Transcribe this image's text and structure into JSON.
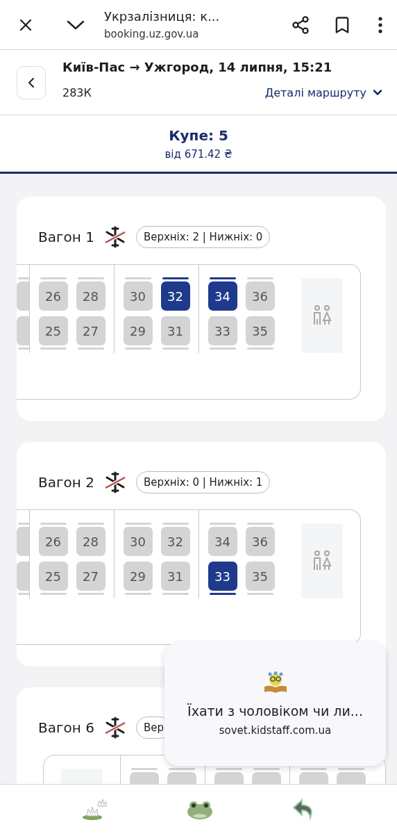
{
  "browser": {
    "title": "Укрзалізниця: к...",
    "url": "booking.uz.gov.ua"
  },
  "header": {
    "route": "Київ-Пас → Ужгород, 14 липня, 15:21",
    "train": "283К",
    "details_link": "Деталі маршруту"
  },
  "tabs": [
    {
      "label": "Купе: 5",
      "price": "від 671.42 ₴",
      "selected": true
    }
  ],
  "wagons": [
    {
      "title": "Вагон 1",
      "berths": "Верхніх: 2 | Нижніх: 0",
      "compartments": [
        {
          "kind": "partial",
          "upper": [
            {
              "selected": false
            }
          ],
          "lower": [
            {
              "selected": false
            }
          ]
        },
        {
          "kind": "seats",
          "upper": [
            {
              "number": "26",
              "selected": false
            },
            {
              "number": "28",
              "selected": false
            }
          ],
          "lower": [
            {
              "number": "25",
              "selected": false
            },
            {
              "number": "27",
              "selected": false
            }
          ]
        },
        {
          "kind": "seats",
          "upper": [
            {
              "number": "30",
              "selected": false
            },
            {
              "number": "32",
              "selected": true
            }
          ],
          "lower": [
            {
              "number": "29",
              "selected": false
            },
            {
              "number": "31",
              "selected": false
            }
          ]
        },
        {
          "kind": "seats",
          "upper": [
            {
              "number": "34",
              "selected": true
            },
            {
              "number": "36",
              "selected": false
            }
          ],
          "lower": [
            {
              "number": "33",
              "selected": false
            },
            {
              "number": "35",
              "selected": false
            }
          ]
        },
        {
          "kind": "toilet"
        }
      ]
    },
    {
      "title": "Вагон 2",
      "berths": "Верхніх: 0 | Нижніх: 1",
      "compartments": [
        {
          "kind": "partial",
          "upper": [
            {
              "selected": false
            }
          ],
          "lower": [
            {
              "selected": false
            }
          ]
        },
        {
          "kind": "seats",
          "upper": [
            {
              "number": "26",
              "selected": false
            },
            {
              "number": "28",
              "selected": false
            }
          ],
          "lower": [
            {
              "number": "25",
              "selected": false
            },
            {
              "number": "27",
              "selected": false
            }
          ]
        },
        {
          "kind": "seats",
          "upper": [
            {
              "number": "30",
              "selected": false
            },
            {
              "number": "32",
              "selected": false
            }
          ],
          "lower": [
            {
              "number": "29",
              "selected": false
            },
            {
              "number": "31",
              "selected": false
            }
          ]
        },
        {
          "kind": "seats",
          "upper": [
            {
              "number": "34",
              "selected": false
            },
            {
              "number": "36",
              "selected": false
            }
          ],
          "lower": [
            {
              "number": "33",
              "selected": true
            },
            {
              "number": "35",
              "selected": false
            }
          ]
        },
        {
          "kind": "toilet"
        }
      ]
    },
    {
      "title": "Вагон 6",
      "berths": "Вер",
      "compartments": [
        {
          "kind": "service"
        },
        {
          "kind": "seats",
          "upper": [
            {
              "selected": false
            },
            {
              "selected": false
            }
          ]
        },
        {
          "kind": "seats",
          "upper": [
            {
              "selected": false
            },
            {
              "selected": false
            }
          ]
        },
        {
          "kind": "seats",
          "upper": [
            {
              "selected": false
            },
            {
              "selected": false
            }
          ]
        }
      ]
    }
  ],
  "popup": {
    "title": "Їхати з чоловіком чи ли...",
    "url": "sovet.kidstaff.com.ua"
  }
}
